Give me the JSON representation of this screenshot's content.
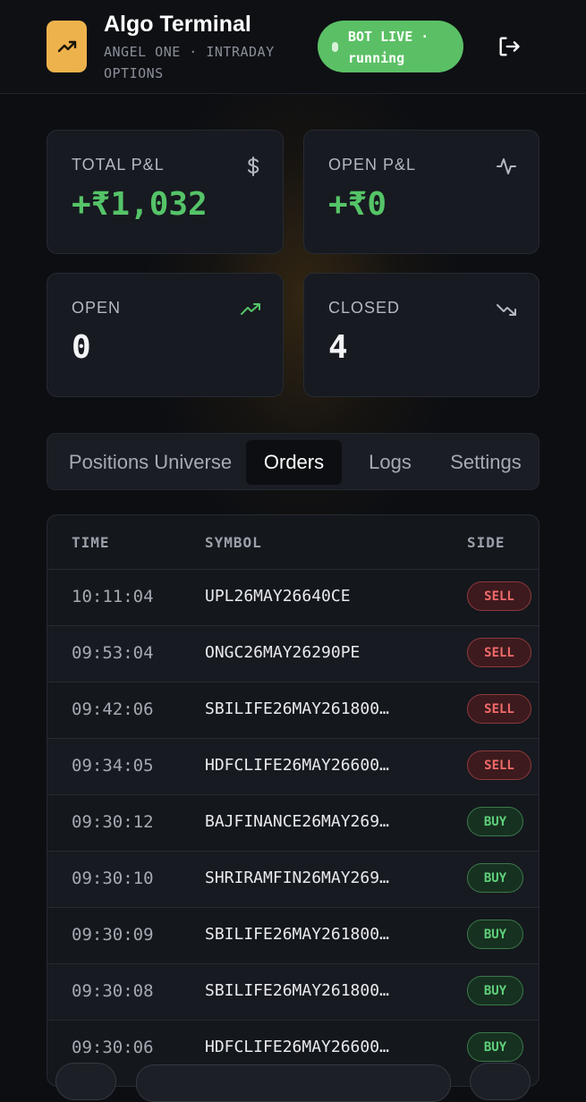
{
  "header": {
    "title": "Algo Terminal",
    "subtitle": "ANGEL ONE · INTRADAY OPTIONS",
    "bot_status": "BOT LIVE · running",
    "logo_icon": "trending-up-icon",
    "logout_icon": "logout-icon",
    "accent_color": "#eeb24c",
    "live_color": "#5bc065"
  },
  "stats": {
    "total_pnl": {
      "label": "TOTAL P&L",
      "value": "+₹1,032",
      "icon": "dollar-icon"
    },
    "open_pnl": {
      "label": "OPEN P&L",
      "value": "+₹0",
      "icon": "activity-icon"
    },
    "open": {
      "label": "OPEN",
      "value": "0",
      "icon": "trending-up-icon"
    },
    "closed": {
      "label": "CLOSED",
      "value": "4",
      "icon": "trending-down-icon"
    }
  },
  "tabs": [
    {
      "label": "Positions Universe",
      "active": false
    },
    {
      "label": "Orders",
      "active": true
    },
    {
      "label": "Logs",
      "active": false
    },
    {
      "label": "Settings",
      "active": false
    }
  ],
  "orders": {
    "columns": [
      "TIME",
      "SYMBOL",
      "SIDE"
    ],
    "rows": [
      {
        "time": "10:11:04",
        "symbol": "UPL26MAY26640CE",
        "side": "SELL"
      },
      {
        "time": "09:53:04",
        "symbol": "ONGC26MAY26290PE",
        "side": "SELL"
      },
      {
        "time": "09:42:06",
        "symbol": "SBILIFE26MAY261800…",
        "side": "SELL"
      },
      {
        "time": "09:34:05",
        "symbol": "HDFCLIFE26MAY26600…",
        "side": "SELL"
      },
      {
        "time": "09:30:12",
        "symbol": "BAJFINANCE26MAY269…",
        "side": "BUY"
      },
      {
        "time": "09:30:10",
        "symbol": "SHRIRAMFIN26MAY269…",
        "side": "BUY"
      },
      {
        "time": "09:30:09",
        "symbol": "SBILIFE26MAY261800…",
        "side": "BUY"
      },
      {
        "time": "09:30:08",
        "symbol": "SBILIFE26MAY261800…",
        "side": "BUY"
      },
      {
        "time": "09:30:06",
        "symbol": "HDFCLIFE26MAY26600…",
        "side": "BUY"
      }
    ]
  }
}
